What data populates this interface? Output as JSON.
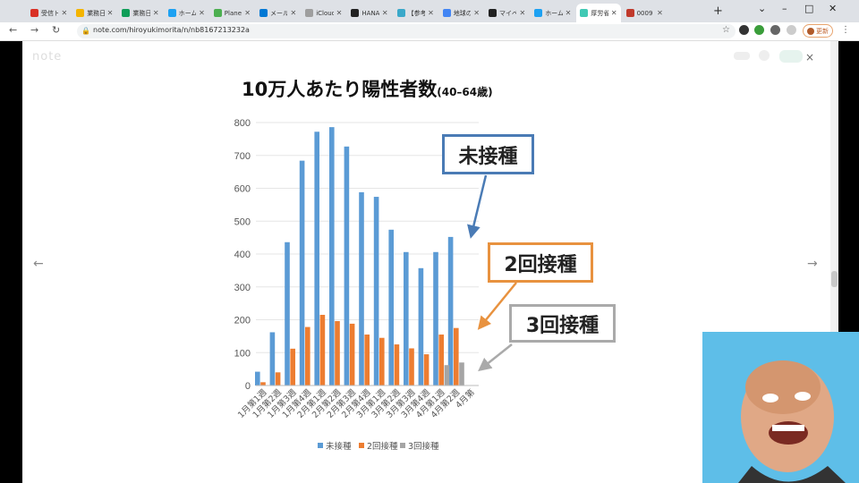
{
  "browser": {
    "tabs": [
      {
        "title": "受信トレ",
        "color": "#d93025"
      },
      {
        "title": "業務日報",
        "color": "#f4b400"
      },
      {
        "title": "業務日報",
        "color": "#0f9d58"
      },
      {
        "title": "ホーム /",
        "color": "#1da1f2"
      },
      {
        "title": "Planet",
        "color": "#4caf50"
      },
      {
        "title": "メール -",
        "color": "#0078d4"
      },
      {
        "title": "iCloud",
        "color": "#9e9e9e"
      },
      {
        "title": "HANA",
        "color": "#222222"
      },
      {
        "title": "【参考",
        "color": "#3aa8c9"
      },
      {
        "title": "地球の",
        "color": "#4285f4"
      },
      {
        "title": "マイペ",
        "color": "#222222"
      },
      {
        "title": "ホーム",
        "color": "#1da1f2"
      },
      {
        "title": "厚労省",
        "color": "#41c9b4"
      },
      {
        "title": "0009",
        "color": "#c0392b"
      }
    ],
    "new_tab": "+",
    "window_controls": {
      "minimize": "–",
      "maximize": "□",
      "close": "✕"
    },
    "nav": {
      "back": "←",
      "forward": "→",
      "reload": "↻"
    },
    "url": "note.com/hiroyukimorita/n/nb8167213232a",
    "update_label": "更新",
    "menu": "⋮"
  },
  "page": {
    "logo": "note",
    "close": "×",
    "prev": "←",
    "next": "→"
  },
  "chart_data": {
    "type": "bar",
    "title": "10万人あたり陽性者数",
    "subtitle": "(40–64歳)",
    "categories": [
      "1月第1週",
      "1月第2週",
      "1月第3週",
      "1月第4週",
      "2月第1週",
      "2月第2週",
      "2月第3週",
      "2月第4週",
      "3月第1週",
      "3月第2週",
      "3月第3週",
      "3月第4週",
      "4月第1週",
      "4月第2週",
      "4月第"
    ],
    "series": [
      {
        "name": "未接種",
        "color": "#5b9bd5",
        "values": [
          42,
          162,
          436,
          684,
          772,
          786,
          727,
          588,
          574,
          474,
          406,
          357,
          406,
          452,
          null
        ]
      },
      {
        "name": "2回接種",
        "color": "#ed7d31",
        "values": [
          10,
          40,
          112,
          178,
          215,
          196,
          188,
          155,
          145,
          125,
          113,
          95,
          155,
          175,
          null
        ]
      },
      {
        "name": "3回接種",
        "color": "#a5a5a5",
        "values": [
          null,
          null,
          null,
          null,
          null,
          null,
          null,
          null,
          null,
          null,
          null,
          null,
          62,
          70,
          null
        ]
      }
    ],
    "ylim": [
      0,
      800
    ],
    "yticks": [
      0,
      100,
      200,
      300,
      400,
      500,
      600,
      700,
      800
    ],
    "legend_position": "bottom",
    "annotations": [
      "未接種",
      "2回接種",
      "3回接種"
    ]
  }
}
